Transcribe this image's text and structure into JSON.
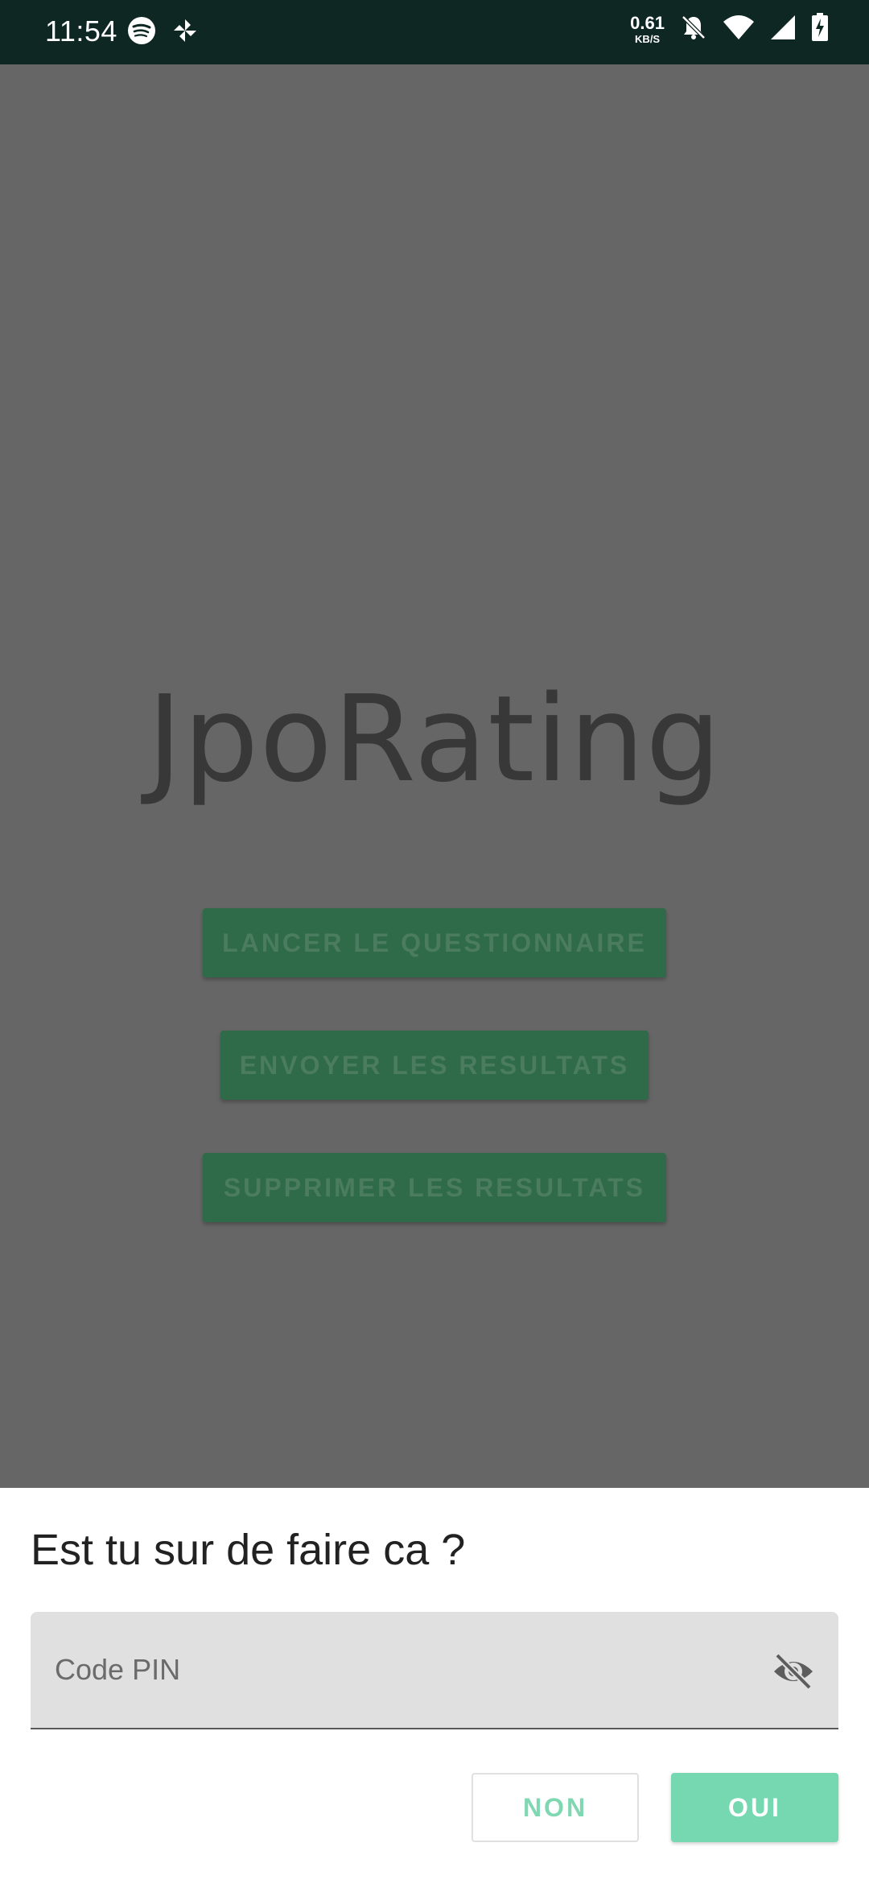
{
  "status_bar": {
    "time": "11:54",
    "net_speed_value": "0.61",
    "net_speed_unit": "KB/S",
    "left_icons": [
      "spotify-icon",
      "pinwheel-icon"
    ],
    "right_icons": [
      "bell-off-icon",
      "wifi-icon",
      "cell-signal-icon",
      "battery-charging-icon"
    ]
  },
  "app": {
    "title": "JpoRating",
    "buttons": {
      "launch": "LANCER LE QUESTIONNAIRE",
      "send": "ENVOYER LES RESULTATS",
      "delete": "SUPPRIMER LES RESULTATS"
    }
  },
  "dialog": {
    "title": "Est tu sur de faire ca ?",
    "pin_placeholder": "Code PIN",
    "pin_value": "",
    "no_label": "NON",
    "yes_label": "OUI"
  },
  "colors": {
    "status_bar": "#0e2723",
    "scrim_background": "#666666",
    "primary_button": "#2f6a49",
    "accent": "#76d8b0"
  }
}
